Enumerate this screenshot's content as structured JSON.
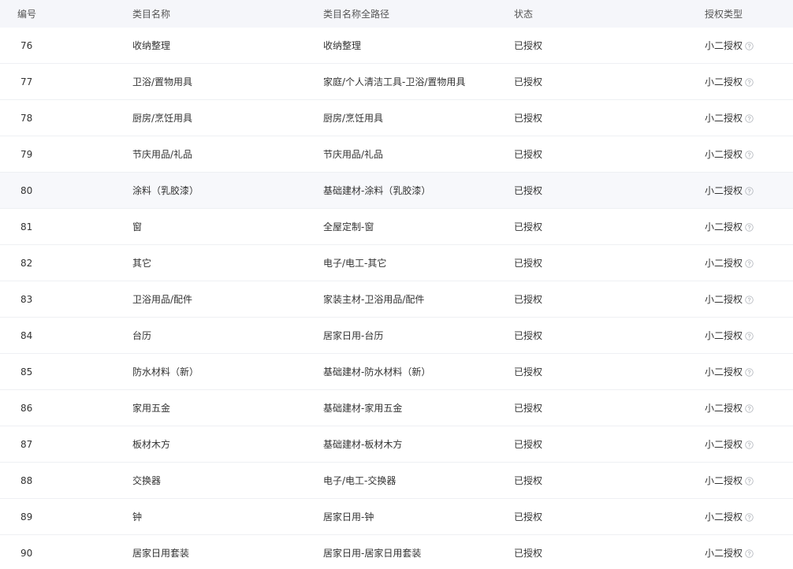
{
  "columns": {
    "id": "编号",
    "name": "类目名称",
    "path": "类目名称全路径",
    "status": "状态",
    "auth_type": "授权类型"
  },
  "help_icon": "question-circle-icon",
  "colors": {
    "header_bg": "#f5f6fa",
    "row_border": "#eef0f3",
    "hover_row_bg": "#f7f8fb",
    "icon": "#b0b4ba"
  },
  "highlighted_row_id": "80",
  "rows": [
    {
      "id": "76",
      "name": "收纳整理",
      "path": "收纳整理",
      "status": "已授权",
      "auth_type": "小二授权"
    },
    {
      "id": "77",
      "name": "卫浴/置物用具",
      "path": "家庭/个人清洁工具-卫浴/置物用具",
      "status": "已授权",
      "auth_type": "小二授权"
    },
    {
      "id": "78",
      "name": "厨房/烹饪用具",
      "path": "厨房/烹饪用具",
      "status": "已授权",
      "auth_type": "小二授权"
    },
    {
      "id": "79",
      "name": "节庆用品/礼品",
      "path": "节庆用品/礼品",
      "status": "已授权",
      "auth_type": "小二授权"
    },
    {
      "id": "80",
      "name": "涂料（乳胶漆）",
      "path": "基础建材-涂料（乳胶漆）",
      "status": "已授权",
      "auth_type": "小二授权"
    },
    {
      "id": "81",
      "name": "窗",
      "path": "全屋定制-窗",
      "status": "已授权",
      "auth_type": "小二授权"
    },
    {
      "id": "82",
      "name": "其它",
      "path": "电子/电工-其它",
      "status": "已授权",
      "auth_type": "小二授权"
    },
    {
      "id": "83",
      "name": "卫浴用品/配件",
      "path": "家装主材-卫浴用品/配件",
      "status": "已授权",
      "auth_type": "小二授权"
    },
    {
      "id": "84",
      "name": "台历",
      "path": "居家日用-台历",
      "status": "已授权",
      "auth_type": "小二授权"
    },
    {
      "id": "85",
      "name": "防水材料（新）",
      "path": "基础建材-防水材料（新）",
      "status": "已授权",
      "auth_type": "小二授权"
    },
    {
      "id": "86",
      "name": "家用五金",
      "path": "基础建材-家用五金",
      "status": "已授权",
      "auth_type": "小二授权"
    },
    {
      "id": "87",
      "name": "板材木方",
      "path": "基础建材-板材木方",
      "status": "已授权",
      "auth_type": "小二授权"
    },
    {
      "id": "88",
      "name": "交换器",
      "path": "电子/电工-交换器",
      "status": "已授权",
      "auth_type": "小二授权"
    },
    {
      "id": "89",
      "name": "钟",
      "path": "居家日用-钟",
      "status": "已授权",
      "auth_type": "小二授权"
    },
    {
      "id": "90",
      "name": "居家日用套装",
      "path": "居家日用-居家日用套装",
      "status": "已授权",
      "auth_type": "小二授权"
    }
  ]
}
